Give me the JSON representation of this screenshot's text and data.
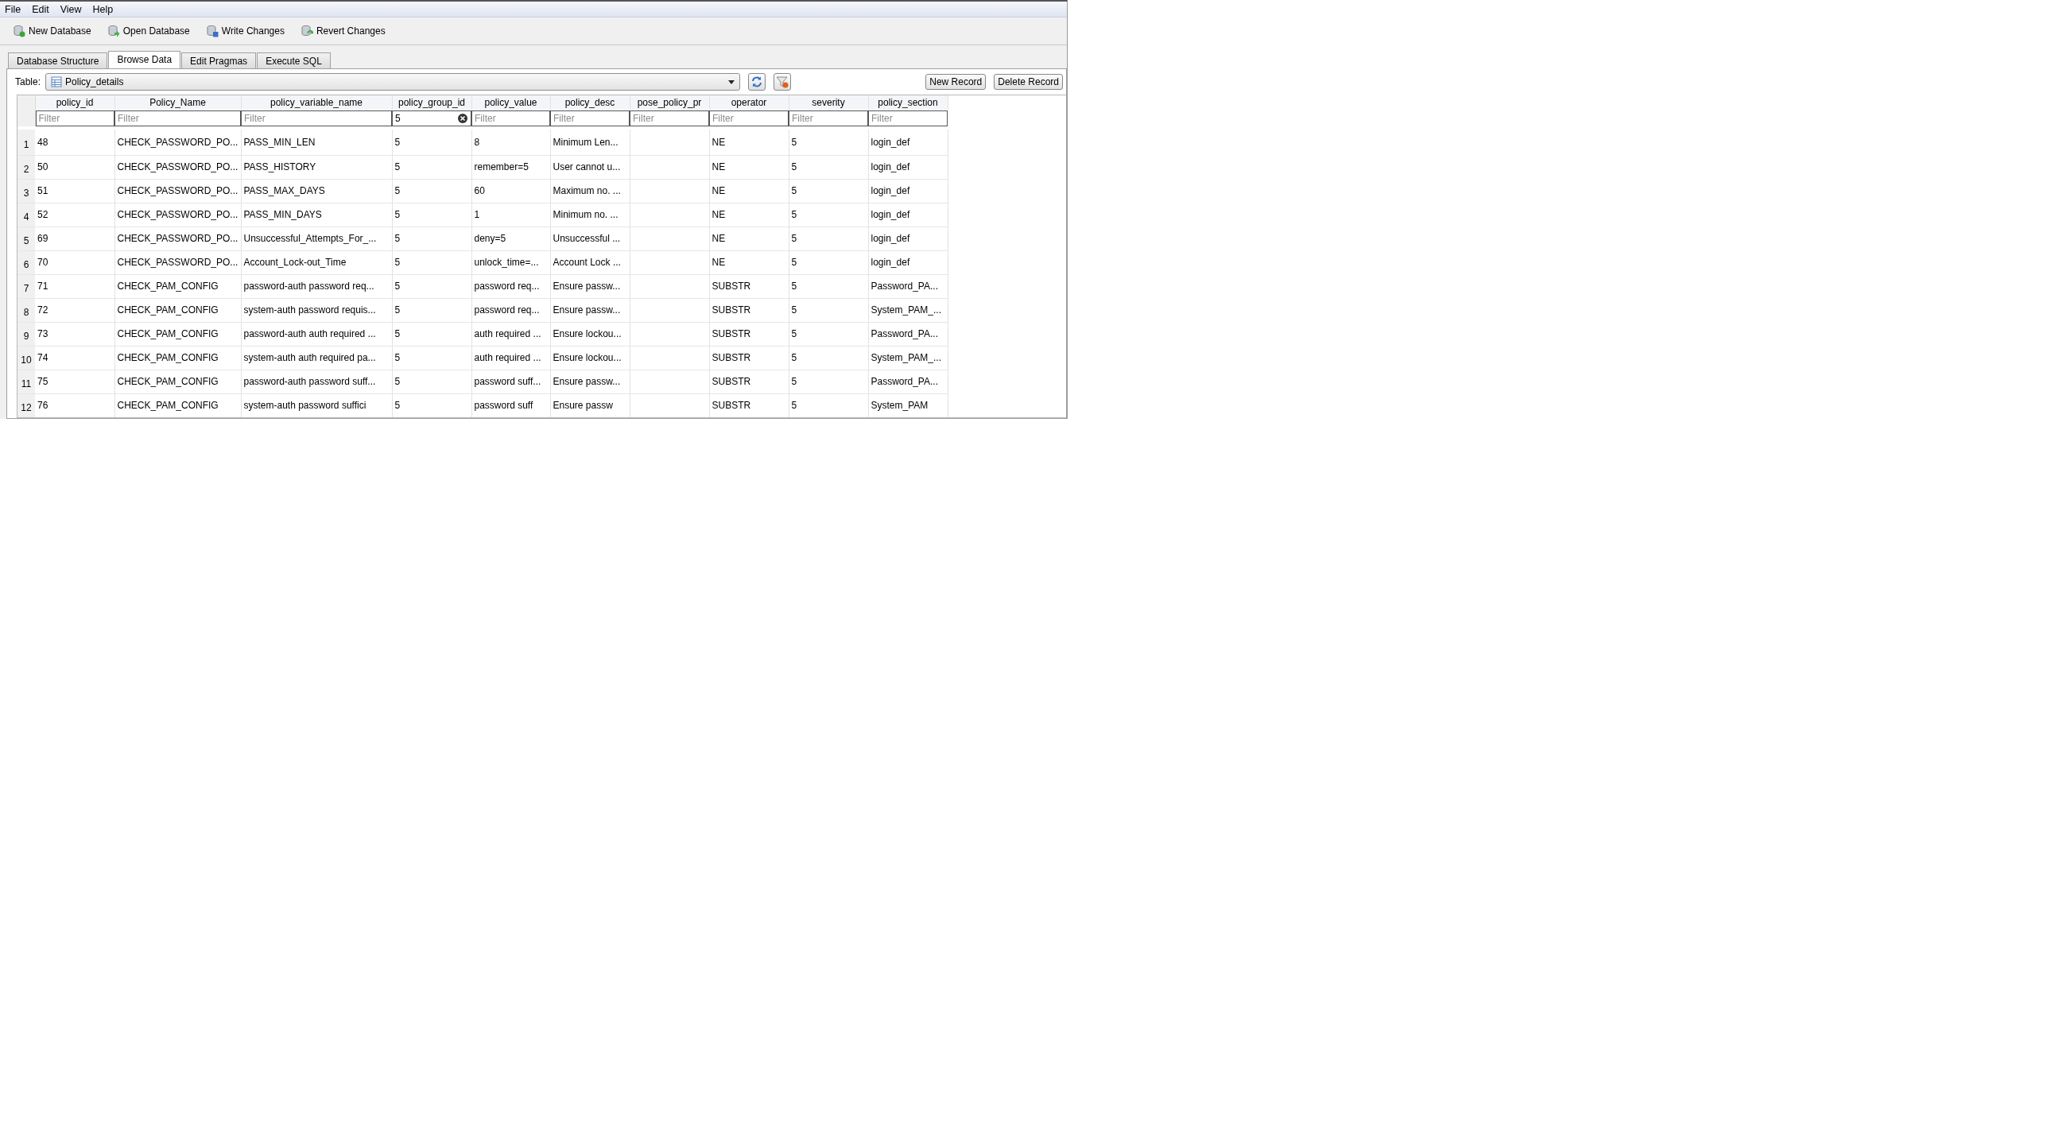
{
  "menu": [
    "File",
    "Edit",
    "View",
    "Help"
  ],
  "toolbar": [
    {
      "label": "New Database",
      "kind": "new"
    },
    {
      "label": "Open Database",
      "kind": "open"
    },
    {
      "label": "Write Changes",
      "kind": "write"
    },
    {
      "label": "Revert Changes",
      "kind": "revert"
    }
  ],
  "tabs": [
    {
      "label": "Database Structure",
      "selected": false
    },
    {
      "label": "Browse Data",
      "selected": true
    },
    {
      "label": "Edit Pragmas",
      "selected": false
    },
    {
      "label": "Execute SQL",
      "selected": false
    }
  ],
  "table_selector": {
    "label": "Table:",
    "value": "Policy_details"
  },
  "record_buttons": [
    "New Record",
    "Delete Record"
  ],
  "columns": [
    {
      "name": "policy_id",
      "placeholder": "Filter"
    },
    {
      "name": "Policy_Name",
      "placeholder": "Filter"
    },
    {
      "name": "policy_variable_name",
      "placeholder": "Filter"
    },
    {
      "name": "policy_group_id",
      "value": "5"
    },
    {
      "name": "policy_value",
      "placeholder": "Filter"
    },
    {
      "name": "policy_desc",
      "placeholder": "Filter"
    },
    {
      "name": "pose_policy_pr",
      "placeholder": "Filter"
    },
    {
      "name": "operator",
      "placeholder": "Filter"
    },
    {
      "name": "severity",
      "placeholder": "Filter"
    },
    {
      "name": "policy_section",
      "placeholder": "Filter"
    }
  ],
  "rows": [
    {
      "number": "1",
      "cells": [
        "48",
        "CHECK_PASSWORD_PO...",
        "PASS_MIN_LEN",
        "5",
        "8",
        "Minimum Len...",
        "",
        "NE",
        "5",
        "login_def"
      ]
    },
    {
      "number": "2",
      "cells": [
        "50",
        "CHECK_PASSWORD_PO...",
        "PASS_HISTORY",
        "5",
        "remember=5",
        "User cannot u...",
        "",
        "NE",
        "5",
        "login_def"
      ]
    },
    {
      "number": "3",
      "cells": [
        "51",
        "CHECK_PASSWORD_PO...",
        "PASS_MAX_DAYS",
        "5",
        "60",
        "Maximum no. ...",
        "",
        "NE",
        "5",
        "login_def"
      ]
    },
    {
      "number": "4",
      "cells": [
        "52",
        "CHECK_PASSWORD_PO...",
        "PASS_MIN_DAYS",
        "5",
        "1",
        "Minimum no. ...",
        "",
        "NE",
        "5",
        "login_def"
      ]
    },
    {
      "number": "5",
      "cells": [
        "69",
        "CHECK_PASSWORD_PO...",
        "Unsuccessful_Attempts_For_...",
        "5",
        "deny=5",
        "Unsuccessful ...",
        "",
        "NE",
        "5",
        "login_def"
      ]
    },
    {
      "number": "6",
      "cells": [
        "70",
        "CHECK_PASSWORD_PO...",
        "Account_Lock-out_Time",
        "5",
        "unlock_time=...",
        "Account Lock ...",
        "",
        "NE",
        "5",
        "login_def"
      ]
    },
    {
      "number": "7",
      "cells": [
        "71",
        "CHECK_PAM_CONFIG",
        "password-auth password req...",
        "5",
        "password req...",
        "Ensure passw...",
        "",
        "SUBSTR",
        "5",
        "Password_PA..."
      ]
    },
    {
      "number": "8",
      "cells": [
        "72",
        "CHECK_PAM_CONFIG",
        "system-auth password requis...",
        "5",
        "password req...",
        "Ensure passw...",
        "",
        "SUBSTR",
        "5",
        "System_PAM_..."
      ]
    },
    {
      "number": "9",
      "cells": [
        "73",
        "CHECK_PAM_CONFIG",
        "password-auth auth required ...",
        "5",
        "auth required ...",
        "Ensure lockou...",
        "",
        "SUBSTR",
        "5",
        "Password_PA..."
      ]
    },
    {
      "number": "10",
      "cells": [
        "74",
        "CHECK_PAM_CONFIG",
        "system-auth auth required pa...",
        "5",
        "auth required ...",
        "Ensure lockou...",
        "",
        "SUBSTR",
        "5",
        "System_PAM_..."
      ]
    },
    {
      "number": "11",
      "cells": [
        "75",
        "CHECK_PAM_CONFIG",
        "password-auth password suff...",
        "5",
        "password suff...",
        "Ensure passw...",
        "",
        "SUBSTR",
        "5",
        "Password_PA..."
      ]
    },
    {
      "number": "12",
      "cells": [
        "76",
        "CHECK_PAM_CONFIG",
        "system-auth password suffici",
        "5",
        "password suff",
        "Ensure passw",
        "",
        "SUBSTR",
        "5",
        "System_PAM"
      ]
    }
  ]
}
